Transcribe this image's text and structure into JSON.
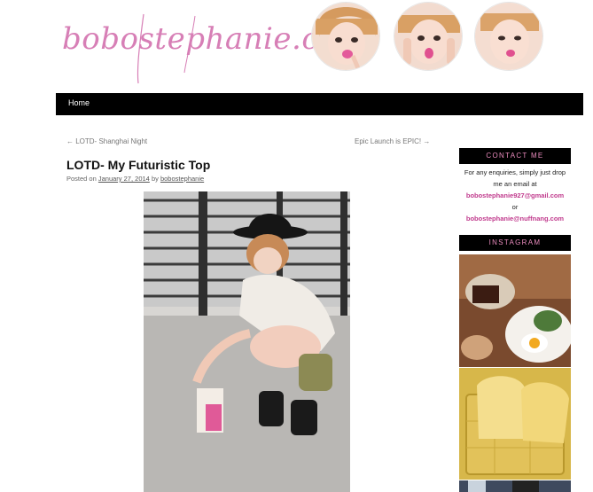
{
  "header": {
    "logo_text": "bobostephanie.com",
    "avatars": [
      "avatar-1",
      "avatar-2",
      "avatar-3"
    ]
  },
  "nav": {
    "home_label": "Home"
  },
  "post_nav": {
    "prev": "← LOTD- Shanghai Night",
    "next": "Epic Launch is EPIC! →"
  },
  "post": {
    "title": "LOTD- My Futuristic Top",
    "meta_prefix": "Posted on",
    "date": "January 27, 2014",
    "meta_by": "by",
    "author": "bobostephanie"
  },
  "sidebar": {
    "contact": {
      "title": "CONTACT ME",
      "intro": "For any enquiries, simply just drop me an email at",
      "email_1": "bobostephanie927@gmail.com",
      "or": "or",
      "email_2": "bobostephanie@nuffnang.com"
    },
    "instagram": {
      "title": "INSTAGRAM"
    }
  },
  "colors": {
    "logo_pink": "#d77fb6",
    "nav_bg": "#000000",
    "widget_title_pink": "#e98bbd",
    "email_pink": "#c0398c"
  }
}
